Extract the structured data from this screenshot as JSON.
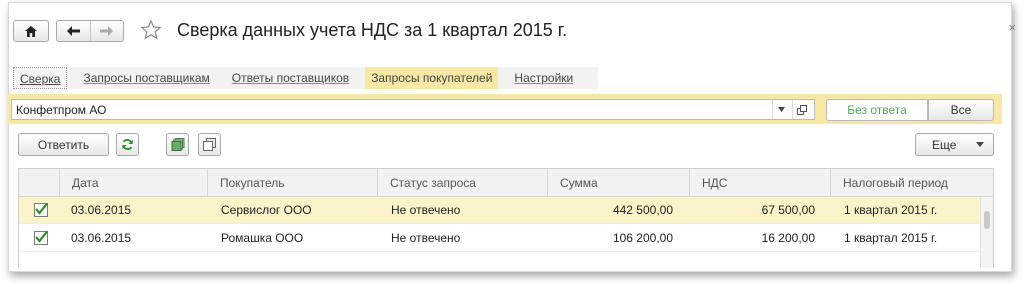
{
  "window": {
    "title": "Сверка данных учета НДС за 1 квартал 2015 г.",
    "close_glyph": "×"
  },
  "tabs": [
    {
      "label": "Сверка",
      "state": "focused"
    },
    {
      "label": "Запросы поставщикам",
      "state": "normal"
    },
    {
      "label": "Ответы поставщиков",
      "state": "normal"
    },
    {
      "label": "Запросы покупателей",
      "state": "active"
    },
    {
      "label": "Настройки",
      "state": "normal"
    }
  ],
  "filter": {
    "counterparty_value": "Конфетпром АО",
    "no_answer_label": "Без ответа",
    "all_label": "Все"
  },
  "toolbar": {
    "reply_label": "Ответить",
    "more_label": "Еще"
  },
  "table": {
    "columns": [
      "Дата",
      "Покупатель",
      "Статус запроса",
      "Сумма",
      "НДС",
      "Налоговый период"
    ],
    "rows": [
      {
        "checked": true,
        "selected": true,
        "date": "03.06.2015",
        "buyer": "Сервислог ООО",
        "status": "Не отвечено",
        "sum": "442 500,00",
        "vat": "67 500,00",
        "period": "1 квартал 2015 г."
      },
      {
        "checked": true,
        "selected": false,
        "date": "03.06.2015",
        "buyer": "Ромашка ООО",
        "status": "Не отвечено",
        "sum": "106 200,00",
        "vat": "16 200,00",
        "period": "1 квартал 2015 г."
      }
    ]
  },
  "colors": {
    "accent_yellow": "#f7e8a6",
    "selected_row": "#fbf4c8",
    "no_answer_green": "#5aa35a",
    "check_green": "#2e8b2e"
  }
}
